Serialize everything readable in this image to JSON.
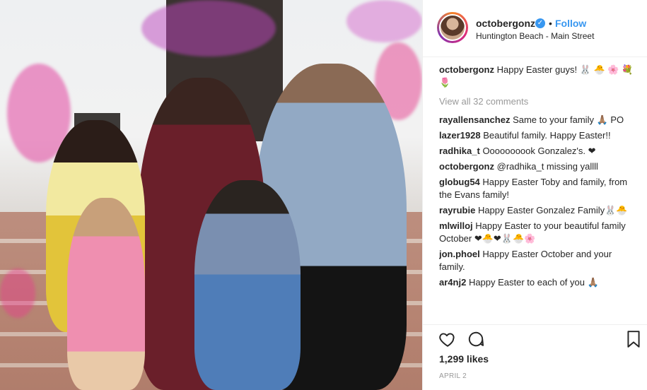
{
  "post": {
    "username": "octobergonz",
    "follow_label": "Follow",
    "separator": "•",
    "location": "Huntington Beach - Main Street",
    "photo_alt": "Family Easter photo"
  },
  "caption": {
    "user": "octobergonz",
    "text": "Happy Easter guys! 🐰 🐣 🌸 💐 🌷"
  },
  "view_all": "View all 32 comments",
  "comments": [
    {
      "user": "rayallensanchez",
      "text": "Same to your family 🙏🏽 PO"
    },
    {
      "user": "lazer1928",
      "text": "Beautiful family. Happy Easter!!"
    },
    {
      "user": "radhika_t",
      "text": "Oooooooook Gonzalez's. ❤"
    },
    {
      "user": "octobergonz",
      "text": "@radhika_t missing yallll"
    },
    {
      "user": "globug54",
      "text": "Happy Easter Toby and family, from the Evans family!"
    },
    {
      "user": "rayrubie",
      "text": "Happy Easter Gonzalez Family🐰🐣"
    },
    {
      "user": "mlwilloj",
      "text": "Happy Easter to your beautiful family October ❤🐣❤🐰🐣🌸"
    },
    {
      "user": "jon.phoel",
      "text": "Happy Easter October and your family."
    },
    {
      "user": "ar4nj2",
      "text": "Happy Easter to each of you 🙏🏽"
    }
  ],
  "actions": {
    "like_icon": "heart-icon",
    "comment_icon": "comment-bubble-icon",
    "save_icon": "bookmark-icon"
  },
  "likes": "1,299 likes",
  "date": "APRIL 2",
  "colors": {
    "link": "#3897f0",
    "text": "#262626",
    "muted": "#999999",
    "border": "#efefef"
  }
}
